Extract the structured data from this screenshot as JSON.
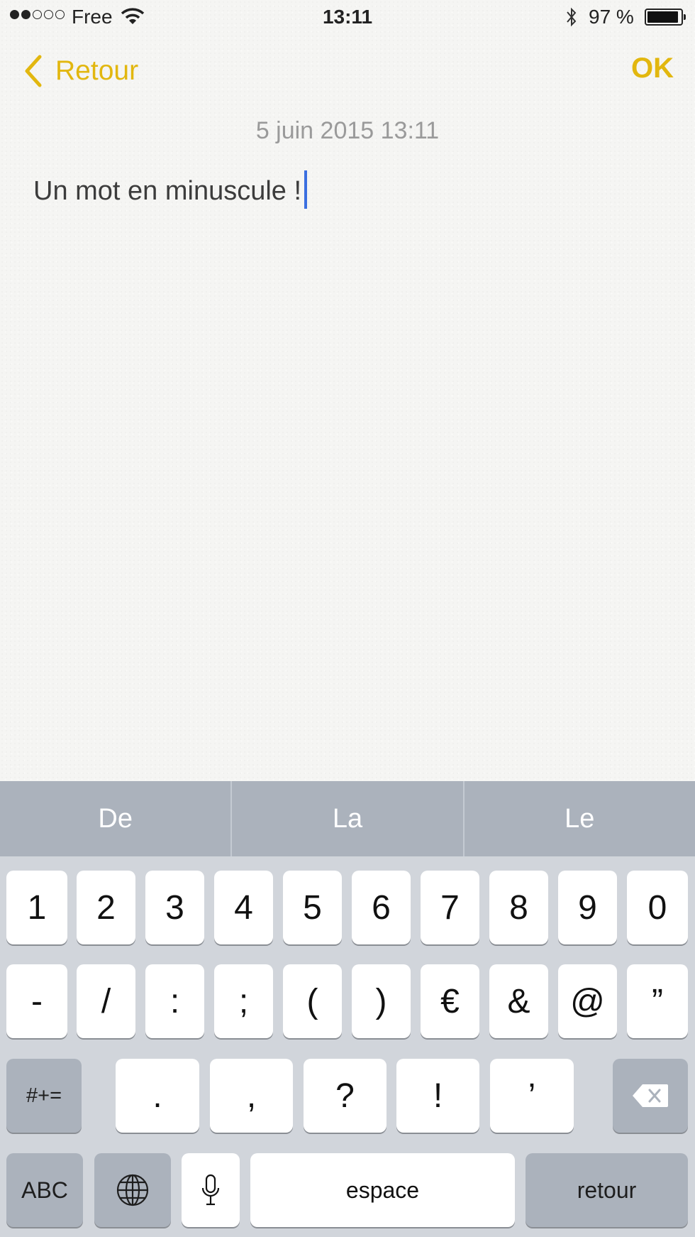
{
  "status_bar": {
    "carrier": "Free",
    "time": "13:11",
    "battery_text": "97 %",
    "signal_bars_filled": 2,
    "signal_bars_total": 5
  },
  "nav": {
    "back_label": "Retour",
    "done_label": "OK"
  },
  "note": {
    "date": "5 juin 2015 13:11",
    "text": "Un mot en minuscule !"
  },
  "colors": {
    "accent": "#e2b70f",
    "caret": "#3b6fe0",
    "keyboard_bg": "#d1d5db",
    "suggestion_bar": "#abb2bc"
  },
  "keyboard": {
    "suggestions": [
      "De",
      "La",
      "Le"
    ],
    "row1": [
      "1",
      "2",
      "3",
      "4",
      "5",
      "6",
      "7",
      "8",
      "9",
      "0"
    ],
    "row2": [
      "-",
      "/",
      ":",
      ";",
      "(",
      ")",
      "€",
      "&",
      "@",
      "”"
    ],
    "row3": {
      "shift_label": "#+=",
      "keys": [
        ".",
        ",",
        "?",
        "!",
        "’"
      ],
      "delete_icon": "backspace-icon"
    },
    "row4": {
      "abc_label": "ABC",
      "globe_icon": "globe-icon",
      "mic_icon": "microphone-icon",
      "space_label": "espace",
      "return_label": "retour"
    }
  }
}
